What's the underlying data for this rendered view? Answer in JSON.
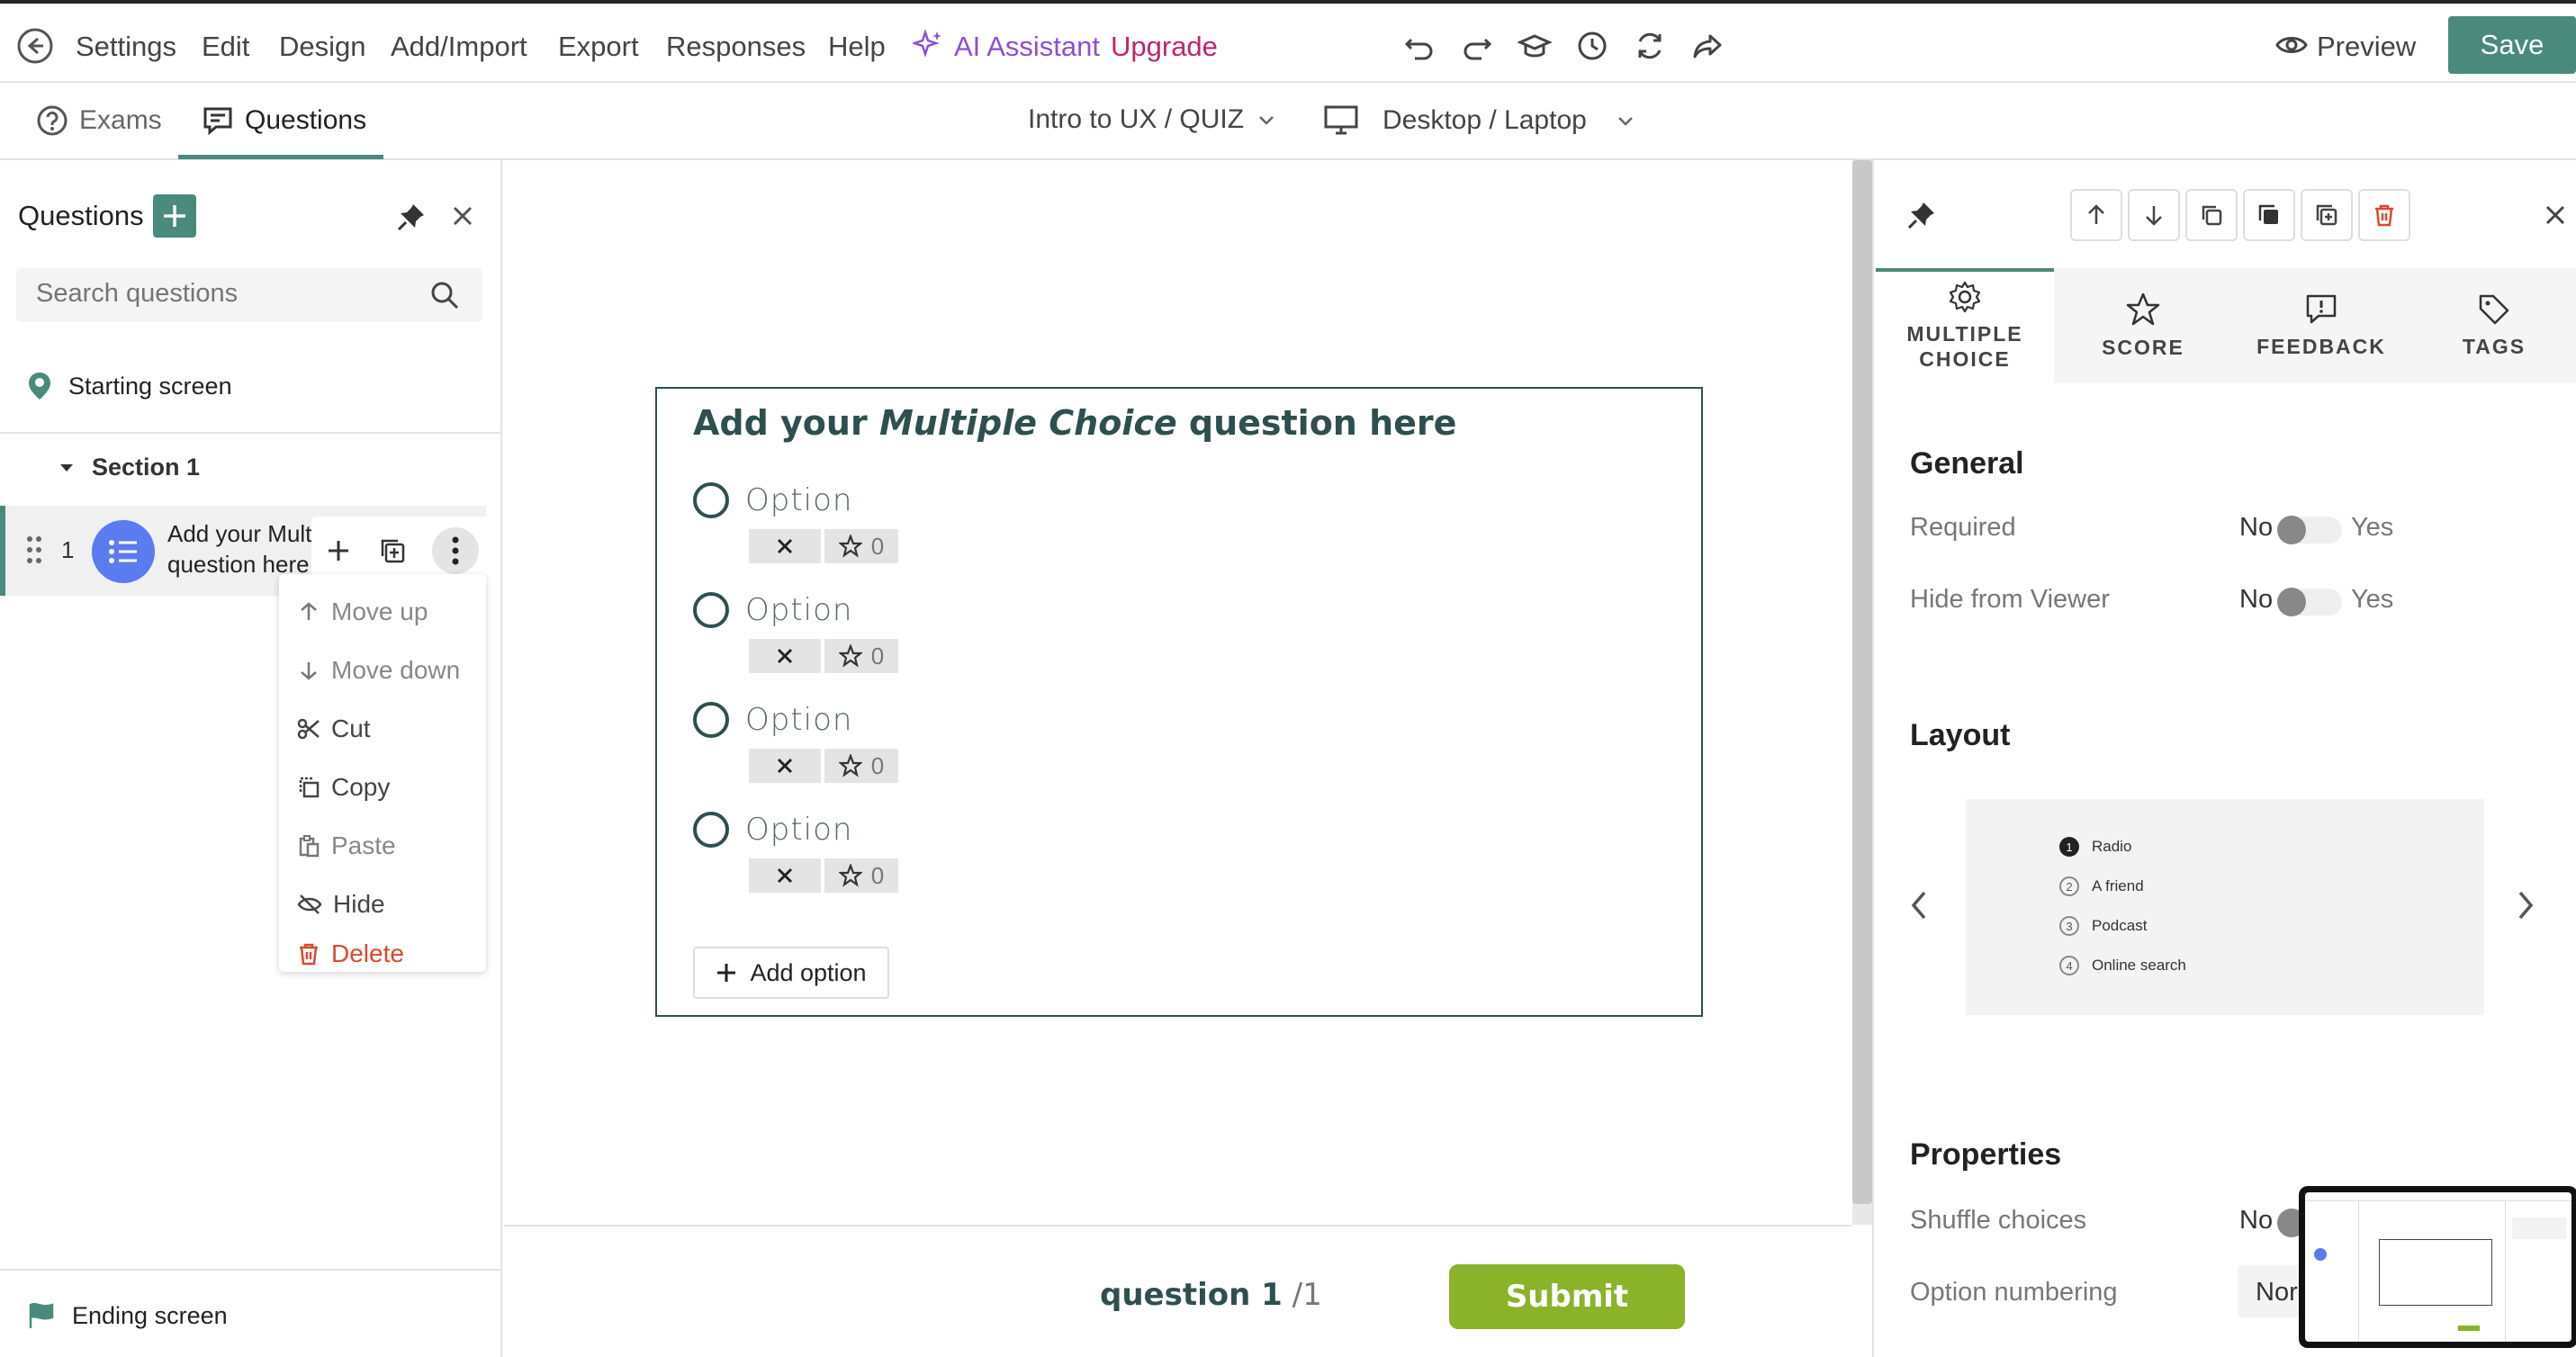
{
  "topbar": {
    "menu": [
      "Settings",
      "Edit",
      "Design",
      "Add/Import",
      "Export",
      "Responses",
      "Help"
    ],
    "ai_assistant": "AI Assistant",
    "upgrade": "Upgrade",
    "preview": "Preview",
    "save": "Save"
  },
  "subbar": {
    "tabs": [
      "Exams",
      "Questions"
    ],
    "active_tab": "Questions",
    "quiz_selector": "Intro to UX / QUIZ",
    "device_selector": "Desktop / Laptop"
  },
  "sidebar": {
    "title": "Questions",
    "search_placeholder": "Search questions",
    "starting_screen": "Starting screen",
    "section": "Section 1",
    "question_number": "1",
    "question_title_line1": "Add your Mult",
    "question_title_line2": "question here",
    "ending_screen": "Ending screen",
    "context_menu": [
      "Move up",
      "Move down",
      "Cut",
      "Copy",
      "Paste",
      "Hide",
      "Delete"
    ]
  },
  "question": {
    "title_prefix": "Add your ",
    "title_emphasis": "Multiple Choice",
    "title_suffix": " question here",
    "options": [
      {
        "label": "Option",
        "score": "0"
      },
      {
        "label": "Option",
        "score": "0"
      },
      {
        "label": "Option",
        "score": "0"
      },
      {
        "label": "Option",
        "score": "0"
      }
    ],
    "add_option": "Add option"
  },
  "footer": {
    "counter_label": "question 1",
    "counter_total": "/1",
    "submit": "Submit"
  },
  "rpanel": {
    "tabs": [
      {
        "line1": "MULTIPLE",
        "line2": "CHOICE"
      },
      {
        "line1": "SCORE",
        "line2": ""
      },
      {
        "line1": "FEEDBACK",
        "line2": ""
      },
      {
        "line1": "TAGS",
        "line2": ""
      }
    ],
    "general_title": "General",
    "required_label": "Required",
    "hide_label": "Hide from Viewer",
    "no": "No",
    "yes": "Yes",
    "layout_title": "Layout",
    "layout_preview": [
      {
        "num": "1",
        "text": "Radio"
      },
      {
        "num": "2",
        "text": "A friend"
      },
      {
        "num": "3",
        "text": "Podcast"
      },
      {
        "num": "4",
        "text": "Online search"
      }
    ],
    "properties_title": "Properties",
    "shuffle_label": "Shuffle choices",
    "shuffle_value": "No",
    "numbering_label": "Option numbering",
    "numbering_value": "Nor"
  },
  "colors": {
    "accent_green": "#4a8a7c",
    "submit_green": "#8ab32a",
    "ai_purple": "#8a4fd8",
    "upgrade_magenta": "#c0256a",
    "delete_red": "#d84a2a",
    "question_avatar": "#5b7cf0"
  }
}
